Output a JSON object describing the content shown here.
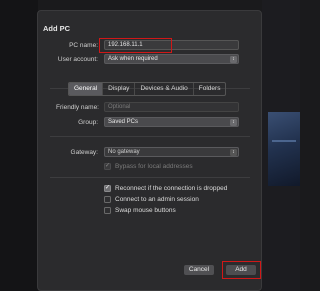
{
  "dialog": {
    "title": "Add PC",
    "pc_name_label": "PC name:",
    "pc_name_value": "192.168.11.1",
    "user_account_label": "User account:",
    "user_account_value": "Ask when required"
  },
  "tabs": [
    "General",
    "Display",
    "Devices & Audio",
    "Folders"
  ],
  "active_tab": "General",
  "general": {
    "friendly_name_label": "Friendly name:",
    "friendly_name_placeholder": "Optional",
    "group_label": "Group:",
    "group_value": "Saved PCs",
    "gateway_label": "Gateway:",
    "gateway_value": "No gateway",
    "bypass_label": "Bypass for local addresses"
  },
  "options": [
    {
      "label": "Reconnect if the connection is dropped",
      "checked": true
    },
    {
      "label": "Connect to an admin session",
      "checked": false
    },
    {
      "label": "Swap mouse buttons",
      "checked": false
    }
  ],
  "buttons": {
    "cancel": "Cancel",
    "add": "Add"
  },
  "colors": {
    "highlight": "#d01818",
    "sheet_background": "#2b2b2d"
  },
  "icons": {
    "popup_chevron": "up-down-chevron-icon",
    "checkmark": "checkmark-icon"
  }
}
